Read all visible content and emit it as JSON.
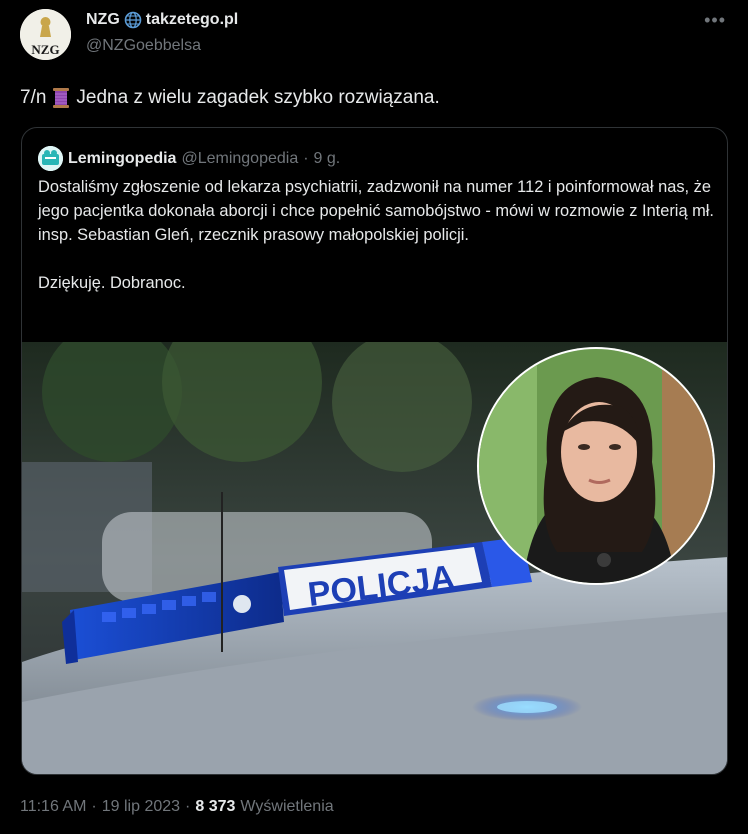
{
  "author": {
    "name": "NZG",
    "site_label": "takzetego.pl",
    "handle": "@NZGoebbelsa",
    "avatar_text": "NZG",
    "verified_site_icon": "globe-icon"
  },
  "tweet": {
    "prefix": "7/n",
    "thread_icon": "spool-of-thread-icon",
    "text": "Jedna z wielu zagadek szybko rozwiązana."
  },
  "quote": {
    "name": "Lemingopedia",
    "handle": "@Lemingopedia",
    "separator": "·",
    "time": "9 g.",
    "paragraph_1": "Dostaliśmy zgłoszenie od lekarza psychiatrii, zadzwonił na numer 112 i poinformował nas, że jego pacjentka dokonała aborcji i chce popełnić samobójstwo - mówi w rozmowie z Interią mł. insp. Sebastian Gleń, rzecznik prasowy małopolskiej policji.",
    "paragraph_2": "Dziękuję. Dobranoc.",
    "image_caption_text": "POLICJA"
  },
  "meta": {
    "time": "11:16 AM",
    "sep1": "·",
    "date": "19 lip 2023",
    "sep2": "·",
    "views_count": "8 373",
    "views_label": "Wyświetlenia"
  },
  "colors": {
    "background": "#000000",
    "primary_text": "#e7e9ea",
    "secondary_text": "#71767b",
    "border": "#2f3336"
  }
}
